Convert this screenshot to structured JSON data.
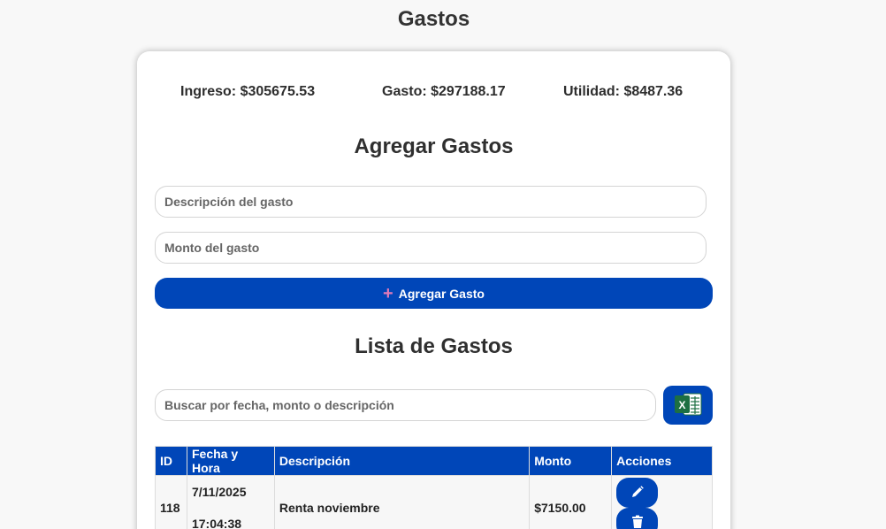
{
  "page": {
    "title": "Gastos"
  },
  "summary": {
    "ingreso": "Ingreso: $305675.53",
    "gasto": "Gasto: $297188.17",
    "utilidad": "Utilidad: $8487.36"
  },
  "add_section": {
    "title": "Agregar Gastos",
    "description_placeholder": "Descripción del gasto",
    "description_value": "",
    "amount_placeholder": "Monto del gasto",
    "amount_value": "",
    "button_label": "Agregar Gasto"
  },
  "list_section": {
    "title": "Lista de Gastos",
    "search_placeholder": "Buscar por fecha, monto o descripción",
    "search_value": ""
  },
  "table": {
    "headers": [
      "ID",
      "Fecha y Hora",
      "Descripción",
      "Monto",
      "Acciones"
    ],
    "rows": [
      {
        "id": "118",
        "date": "7/11/2025",
        "time": "17:04:38",
        "description": "Renta noviembre",
        "amount": "$7150.00"
      }
    ]
  },
  "icons": {
    "add": "plus-icon",
    "export": "excel-icon",
    "edit": "pencil-icon",
    "delete": "trash-icon"
  },
  "colors": {
    "primary": "#0046b8",
    "excel_green": "#1d6f42",
    "plus_accent": "#e07ab8"
  }
}
